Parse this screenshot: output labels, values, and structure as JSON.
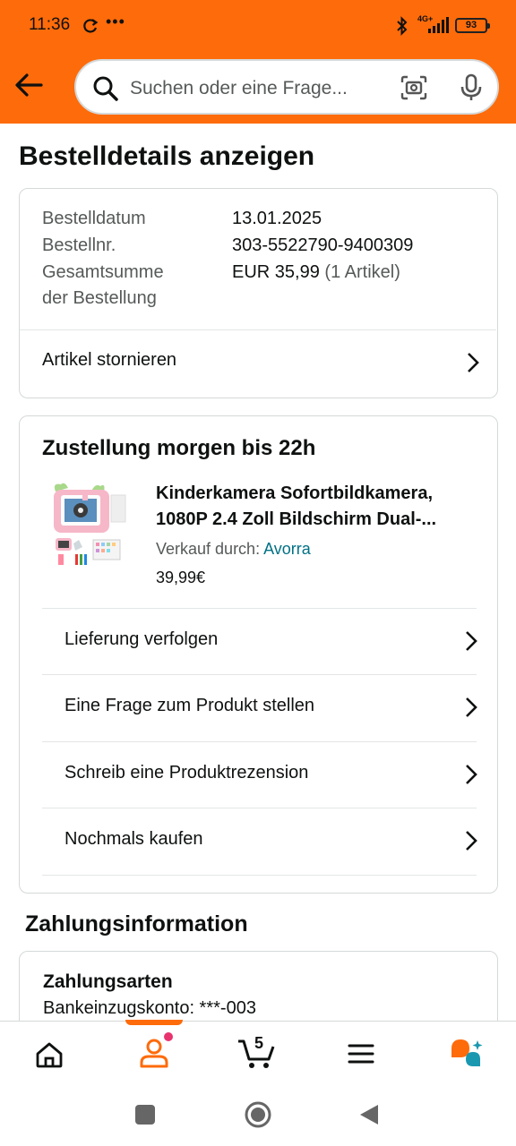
{
  "status_bar": {
    "time": "11:36",
    "network": "4G+",
    "battery": "93"
  },
  "search": {
    "placeholder": "Suchen oder eine Frage..."
  },
  "page": {
    "title": "Bestelldetails anzeigen"
  },
  "order": {
    "date_label": "Bestelldatum",
    "date_value": "13.01.2025",
    "number_label": "Bestellnr.",
    "number_value": "303-5522790-9400309",
    "total_label_1": "Gesamtsumme",
    "total_label_2": "der Bestellung",
    "total_value": "EUR 35,99",
    "total_items": "(1 Artikel)",
    "cancel_label": "Artikel stornieren"
  },
  "delivery": {
    "title": "Zustellung morgen bis 22h",
    "product_title_1": "Kinderkamera Sofortbildkamera,",
    "product_title_2": "1080P 2.4 Zoll Bildschirm Dual-...",
    "seller_prefix": "Verkauf durch:",
    "seller_name": "Avorra",
    "price": "39,99€",
    "actions": [
      {
        "label": "Lieferung verfolgen"
      },
      {
        "label": "Eine Frage zum Produkt stellen"
      },
      {
        "label": "Schreib eine Produktrezension"
      },
      {
        "label": "Nochmals kaufen"
      }
    ]
  },
  "payment": {
    "section_title": "Zahlungsinformation",
    "methods_title": "Zahlungsarten",
    "method": "Bankeinzugskonto: ***-003"
  },
  "bottom_nav": {
    "cart_count": "5",
    "items": [
      "home-icon",
      "account-icon",
      "cart-icon",
      "menu-icon",
      "rufus-assistant-icon"
    ],
    "active": "account-icon"
  },
  "colors": {
    "brand_orange": "#fe6b0a",
    "link": "#007185",
    "notification_dot": "#e8336f",
    "teal": "#1a98b0"
  }
}
